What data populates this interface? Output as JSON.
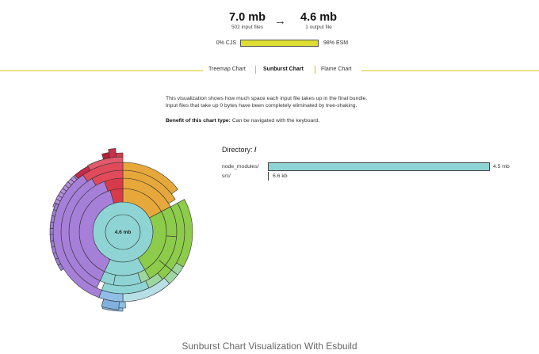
{
  "summary": {
    "input_size": "7.0 mb",
    "input_label": "502 input files",
    "arrow": "→",
    "output_size": "4.6 mb",
    "output_label": "1 output file"
  },
  "format": {
    "cjs_label": "0% CJS",
    "esm_label": "98% ESM",
    "esm_fraction": 0.98,
    "bar_color": "#dddd33"
  },
  "tabs": [
    {
      "label": "Treemap Chart",
      "active": false
    },
    {
      "label": "Sunburst Chart",
      "active": true
    },
    {
      "label": "Flame Chart",
      "active": false
    }
  ],
  "description": {
    "line1": "This visualization shows how much space each input file takes up in the final bundle.",
    "line2": "Input files that take up 0 bytes have been completely eliminated by tree-shaking.",
    "benefit_label": "Benefit of this chart type:",
    "benefit_text": "Can be navigated with the keyboard."
  },
  "sunburst": {
    "center_label": "4.6 mb"
  },
  "directory": {
    "label": "Directory:",
    "path": "/",
    "rows": [
      {
        "name": "node_modules/",
        "size": "4.5 mb",
        "fraction": 1.0
      },
      {
        "name": "src/",
        "size": "6.6 kb",
        "fraction": 0.0015
      }
    ]
  },
  "caption": "Sunburst Chart Visualization With Esbuild",
  "colors": {
    "accent_line": "#d8c21a",
    "center": "#8fd4d4",
    "purple": "#a67fd8",
    "orange": "#e6a83a",
    "green": "#8ccc4a",
    "red": "#d83a4a",
    "teal": "#8fd4d4"
  }
}
